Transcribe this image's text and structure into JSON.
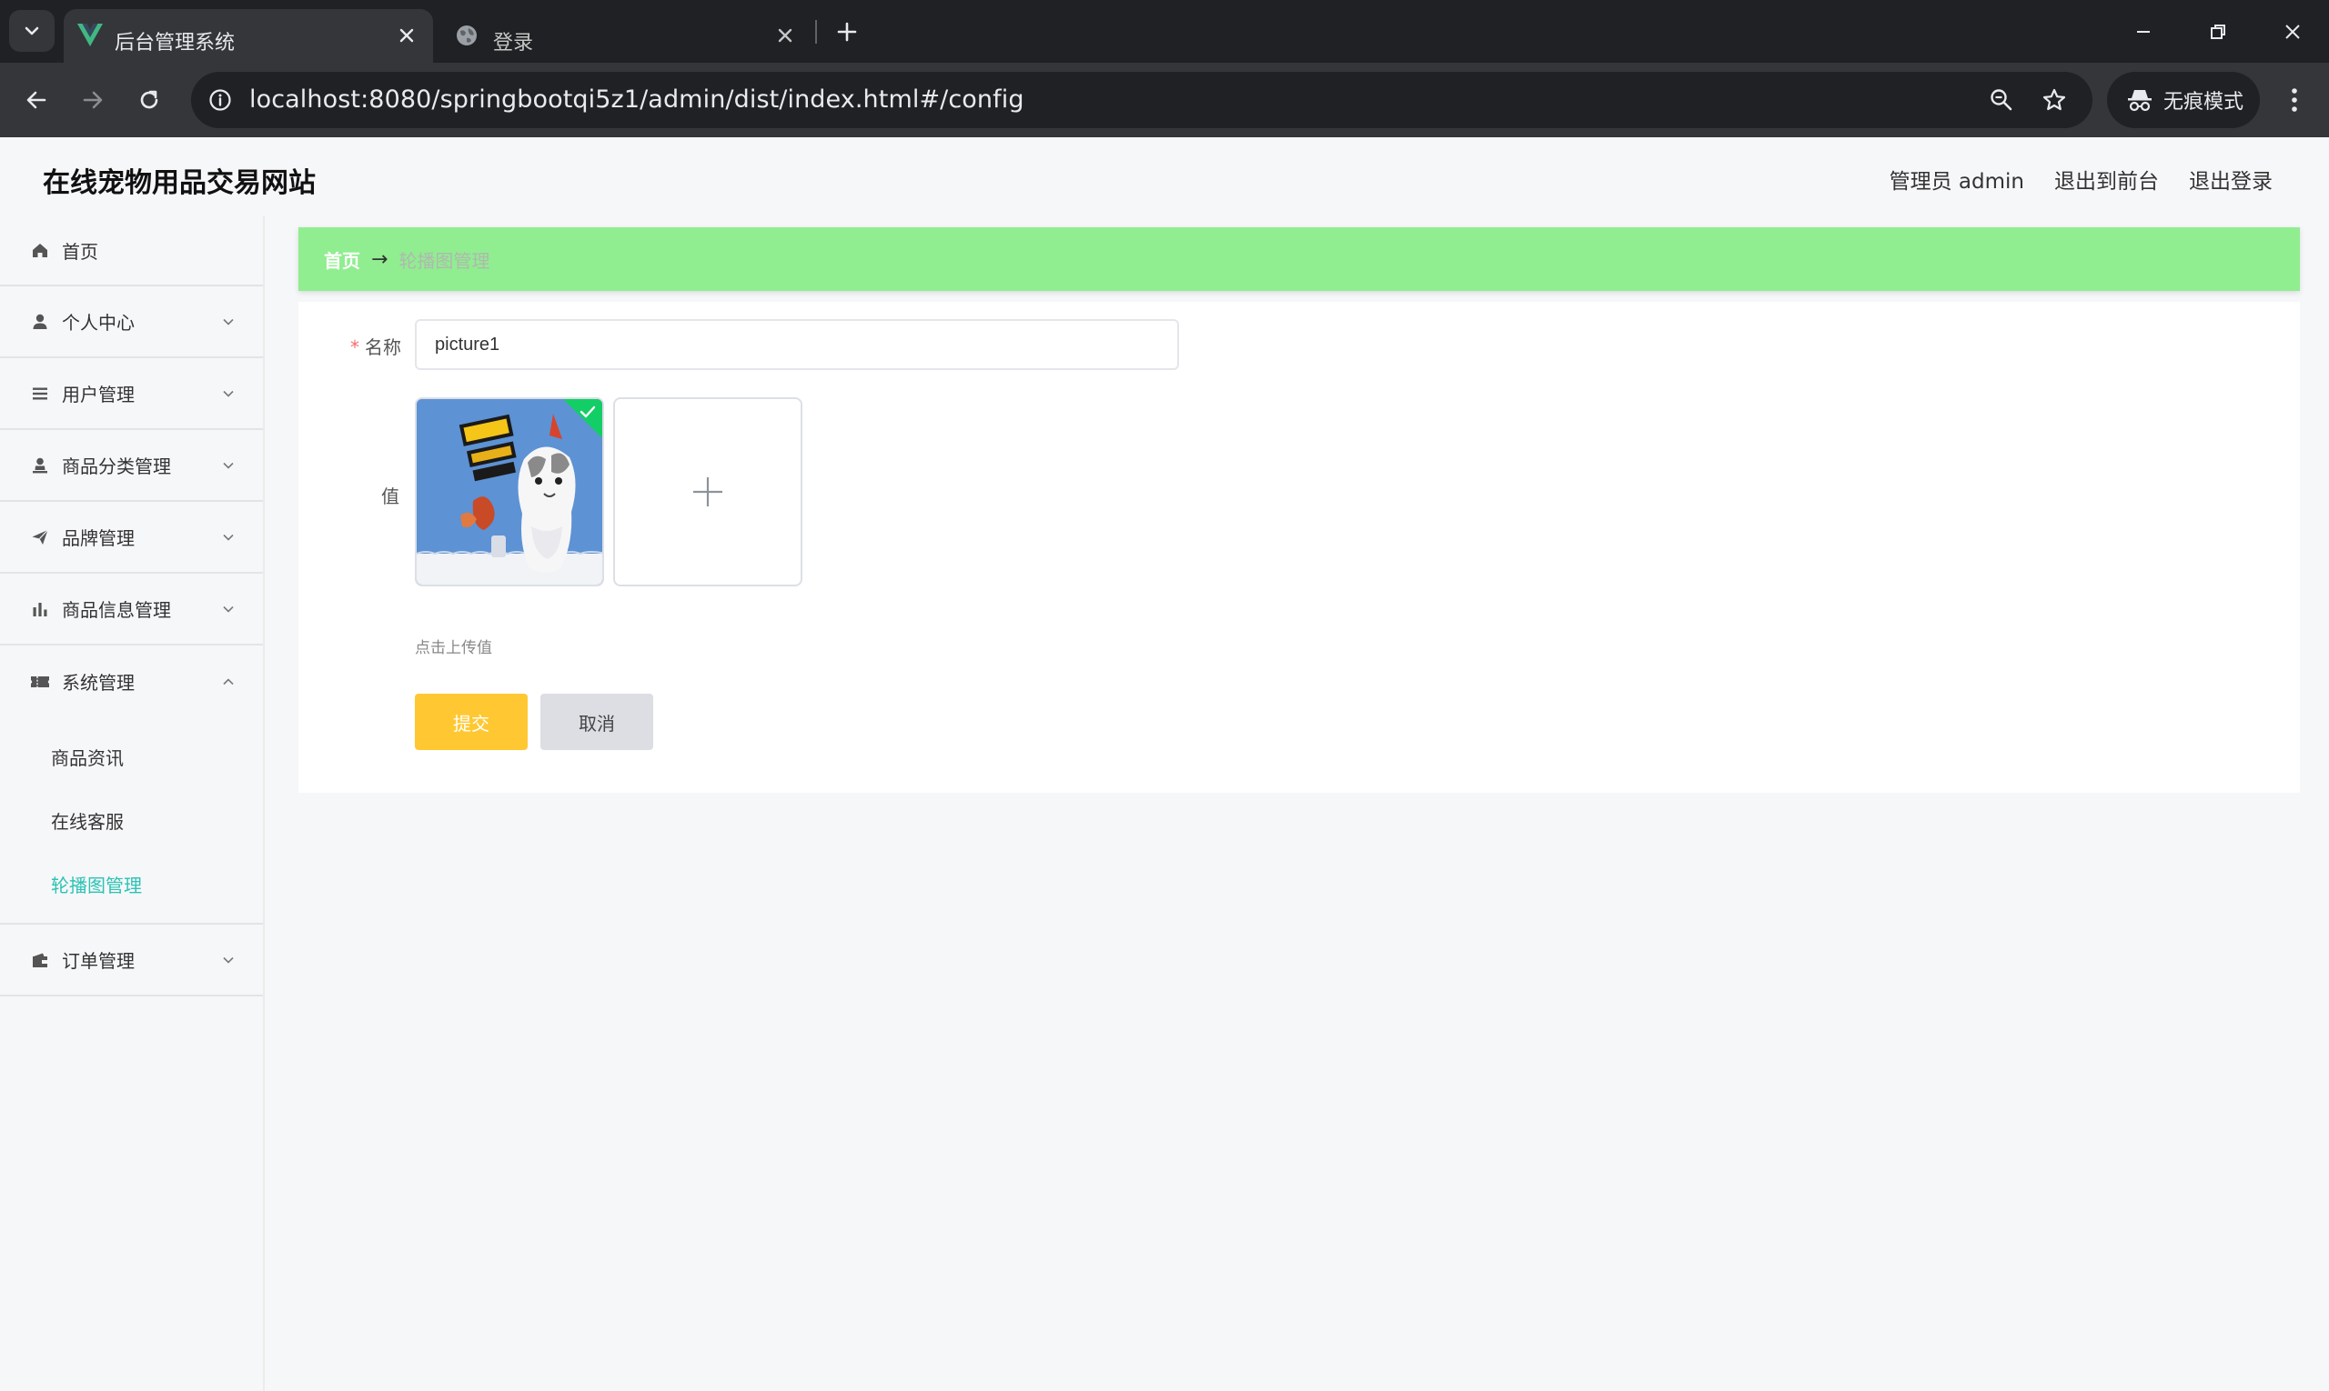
{
  "browser": {
    "tabs": [
      {
        "title": "后台管理系统",
        "active": true,
        "icon": "vue-logo-icon"
      },
      {
        "title": "登录",
        "active": false,
        "icon": "globe-icon"
      }
    ],
    "url_host": "localhost",
    "url_path": ":8080/springbootqi5z1/admin/dist/index.html#/config",
    "incognito_label": "无痕模式"
  },
  "header": {
    "site_title": "在线宠物用品交易网站",
    "admin_label": "管理员 admin",
    "back_to_front": "退出到前台",
    "logout": "退出登录"
  },
  "sidebar": {
    "items": [
      {
        "label": "首页",
        "icon": "home-icon"
      },
      {
        "label": "个人中心",
        "icon": "user-icon"
      },
      {
        "label": "用户管理",
        "icon": "list-icon"
      },
      {
        "label": "商品分类管理",
        "icon": "person-icon"
      },
      {
        "label": "品牌管理",
        "icon": "send-icon"
      },
      {
        "label": "商品信息管理",
        "icon": "bar-chart-icon"
      },
      {
        "label": "系统管理",
        "icon": "ticket-icon"
      },
      {
        "label": "订单管理",
        "icon": "wallet-icon"
      }
    ],
    "system_submenu": [
      "商品资讯",
      "在线客服",
      "轮播图管理"
    ]
  },
  "breadcrumb": {
    "home": "首页",
    "separator": "→",
    "current": "轮播图管理"
  },
  "form": {
    "name_label": "名称",
    "name_value": "picture1",
    "value_label": "值",
    "upload_tip": "点击上传值",
    "submit_label": "提交",
    "cancel_label": "取消"
  },
  "colors": {
    "breadcrumb_bg": "#90ee90",
    "active_menu": "#2dc3b4",
    "submit_button": "#ffc832",
    "upload_success": "#13ce66"
  }
}
